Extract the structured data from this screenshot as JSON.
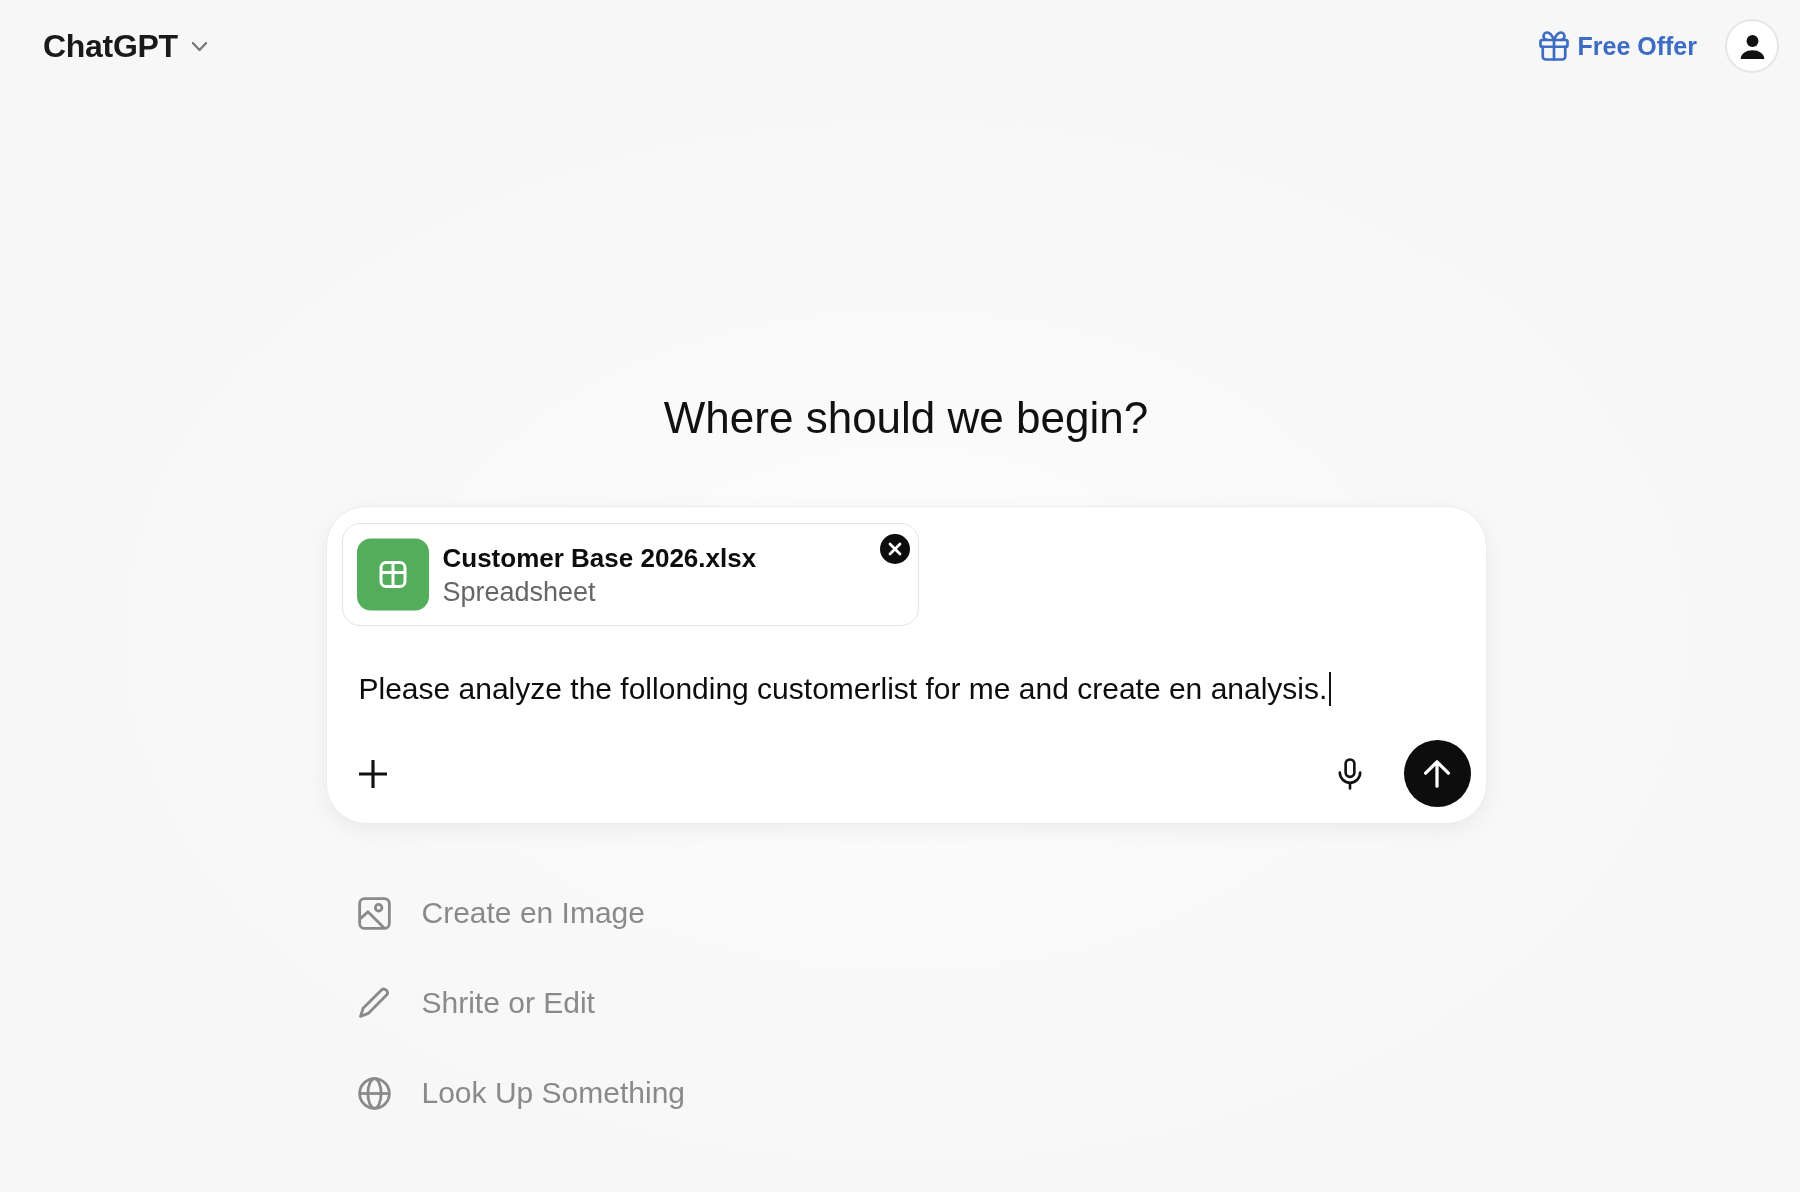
{
  "header": {
    "title": "ChatGPT",
    "offer": "Free Offer"
  },
  "heading": "Where should we begin?",
  "composer": {
    "attachment": {
      "name": "Customer Base 2026.xlsx",
      "type": "Spreadsheet"
    },
    "message": {
      "value": "Please analyze the follonding customerlist for me and create en analysis.",
      "focused": true
    }
  },
  "suggestions": [
    {
      "kind": "image",
      "label": "Create en Image"
    },
    {
      "kind": "edit",
      "label": "Shrite or Edit"
    },
    {
      "kind": "web",
      "label": "Look Up Something"
    }
  ]
}
